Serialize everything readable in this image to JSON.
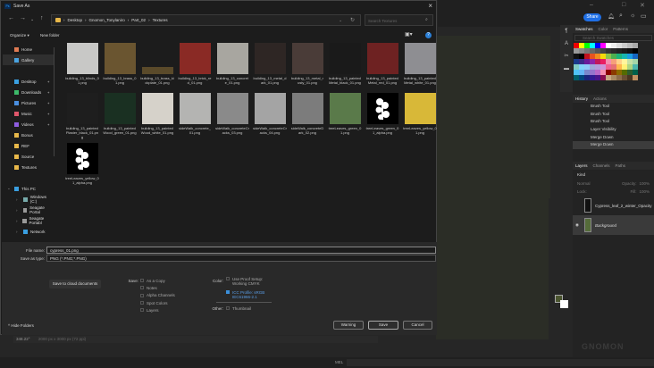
{
  "dialog": {
    "title": "Save As",
    "nav": {
      "breadcrumb": [
        "Desktop",
        "Gnomon_Tonylaniro",
        "Part_02",
        "Textures"
      ],
      "search_placeholder": "Search Textures"
    },
    "toolbar": {
      "organize": "Organize ▾",
      "new_folder": "New folder"
    },
    "sidebar": [
      {
        "label": "Home",
        "color": "#e07b53",
        "pin": false,
        "indent": 0
      },
      {
        "label": "Gallery",
        "color": "#4aa3e0",
        "pin": false,
        "indent": 0,
        "selected": true
      },
      {
        "label": "Desktop",
        "color": "#3a9fe0",
        "pin": true,
        "indent": 0,
        "gap": true
      },
      {
        "label": "Downloads",
        "color": "#3dba6a",
        "pin": true,
        "indent": 0
      },
      {
        "label": "Pictures",
        "color": "#4a8fe0",
        "pin": true,
        "indent": 0
      },
      {
        "label": "Music",
        "color": "#e0566b",
        "pin": true,
        "indent": 0
      },
      {
        "label": "Videos",
        "color": "#8f5de0",
        "pin": true,
        "indent": 0
      },
      {
        "label": "Bonus",
        "color": "#e8b84a",
        "pin": false,
        "indent": 0
      },
      {
        "label": "REF",
        "color": "#e8b84a",
        "pin": false,
        "indent": 0
      },
      {
        "label": "Source",
        "color": "#e8b84a",
        "pin": false,
        "indent": 0
      },
      {
        "label": "Textures",
        "color": "#e8b84a",
        "pin": false,
        "indent": 0
      },
      {
        "label": "This PC",
        "color": "#3a9fe0",
        "pin": false,
        "indent": 0,
        "gap": true,
        "arrow": "⌄"
      },
      {
        "label": "Windows (C:)",
        "color": "#7aa",
        "pin": false,
        "indent": 1,
        "arrow": "›"
      },
      {
        "label": "Seagate Portal",
        "color": "#999",
        "pin": false,
        "indent": 1,
        "arrow": "›"
      },
      {
        "label": "Seagate Portabl",
        "color": "#999",
        "pin": false,
        "indent": 1,
        "arrow": "›"
      },
      {
        "label": "Network",
        "color": "#3a9fe0",
        "pin": false,
        "indent": 1,
        "arrow": "›"
      }
    ],
    "files": [
      {
        "name": "building_13_blinds_01.png",
        "color": "#c8c8c6"
      },
      {
        "name": "building_13_brass_01.png",
        "color": "#6a5530"
      },
      {
        "name": "building_13_brass_kickplate_01.png",
        "color": "#5a4a2a",
        "short": true
      },
      {
        "name": "building_13_brick_red_01.png",
        "color": "#8a2a25"
      },
      {
        "name": "building_13_concrete_01.png",
        "color": "#a8a6a0"
      },
      {
        "name": "building_13_metal_dark_01.png",
        "color": "#2e2624"
      },
      {
        "name": "building_13_metal_rusty_01.png",
        "color": "#4a3c38"
      },
      {
        "name": "building_13_paintedMetal_black_01.png",
        "color": "#1a1a1a"
      },
      {
        "name": "building_13_paintedMetal_red_01.png",
        "color": "#6e2222"
      },
      {
        "name": "building_13_paintedMetal_white_01.png",
        "color": "#8e8e92"
      },
      {
        "name": "building_13_paintedPlaster_black_01.png",
        "color": "#1e1e1e"
      },
      {
        "name": "building_13_paintedWood_green_01.png",
        "color": "#1a3022"
      },
      {
        "name": "building_13_paintedWood_white_01.png",
        "color": "#d6d2ca"
      },
      {
        "name": "sideWalk_concrete_01.png",
        "color": "#b4b4b2"
      },
      {
        "name": "sideWalk_concreteCracks_03.png",
        "color": "#8a8a8a"
      },
      {
        "name": "sideWalk_concreteCracks_04.png",
        "color": "#a4a4a4"
      },
      {
        "name": "sideWalk_concreteDark_02.png",
        "color": "#7c7c7c"
      },
      {
        "name": "treeLeaves_green_01.png",
        "color": "#5a7a4a"
      },
      {
        "name": "treeLeaves_green_01_alpha.png",
        "color": "#000000",
        "alpha": true
      },
      {
        "name": "treeLeaves_yellow_01.png",
        "color": "#d8b838"
      },
      {
        "name": "treeLeaves_yellow_01_alpha.png",
        "color": "#000000",
        "alpha": true
      }
    ],
    "file_name_label": "File name:",
    "file_name": "cypress_01.png",
    "type_label": "Save as type:",
    "type": "PNG (*.PNG;*.PNG)",
    "cloud_button": "Save to cloud documents",
    "save_label": "Save:",
    "save_options": [
      {
        "label": "As a Copy",
        "checked": true
      },
      {
        "label": "Notes",
        "checked": false
      },
      {
        "label": "Alpha Channels",
        "checked": false
      },
      {
        "label": "Spot Colors",
        "checked": false
      },
      {
        "label": "Layers",
        "checked": false
      }
    ],
    "color_label": "Color:",
    "proof": {
      "label": "Use Proof Setup:",
      "sub": "Working CMYK"
    },
    "icc": {
      "label": "ICC Profile:  sRGB",
      "sub": "IEC61966-2.1"
    },
    "other_label": "Other:",
    "thumbnail": "Thumbnail",
    "hide_folders": "Hide Folders",
    "buttons": {
      "warning": "Warning",
      "save": "Save",
      "cancel": "Cancel"
    }
  },
  "photoshop": {
    "share": "Share",
    "swatches_tabs": [
      "Swatches",
      "Color",
      "Patterns"
    ],
    "swatch_search": "Search Swatches",
    "history_tabs": [
      "History",
      "Actions"
    ],
    "history": [
      "Brush Tool",
      "Brush Tool",
      "Brush Tool",
      "Layer Visibility",
      "Merge Down",
      "Merge Down"
    ],
    "layers_tabs": [
      "Layers",
      "Channels",
      "Paths"
    ],
    "kind": "Kind",
    "blend": "Normal",
    "opacity_label": "Opacity:",
    "opacity": "100%",
    "lock_label": "Lock:",
    "fill_label": "Fill:",
    "fill": "100%",
    "layers": [
      "Cypress_leaf_2_winter_Opacity",
      "Background"
    ],
    "status": {
      "zoom": "348.22°",
      "size": "2000 px x 3000 px (72 ppi)"
    },
    "bottom_field": "MEL",
    "watermark": "GNOMON WORKSHOP"
  }
}
